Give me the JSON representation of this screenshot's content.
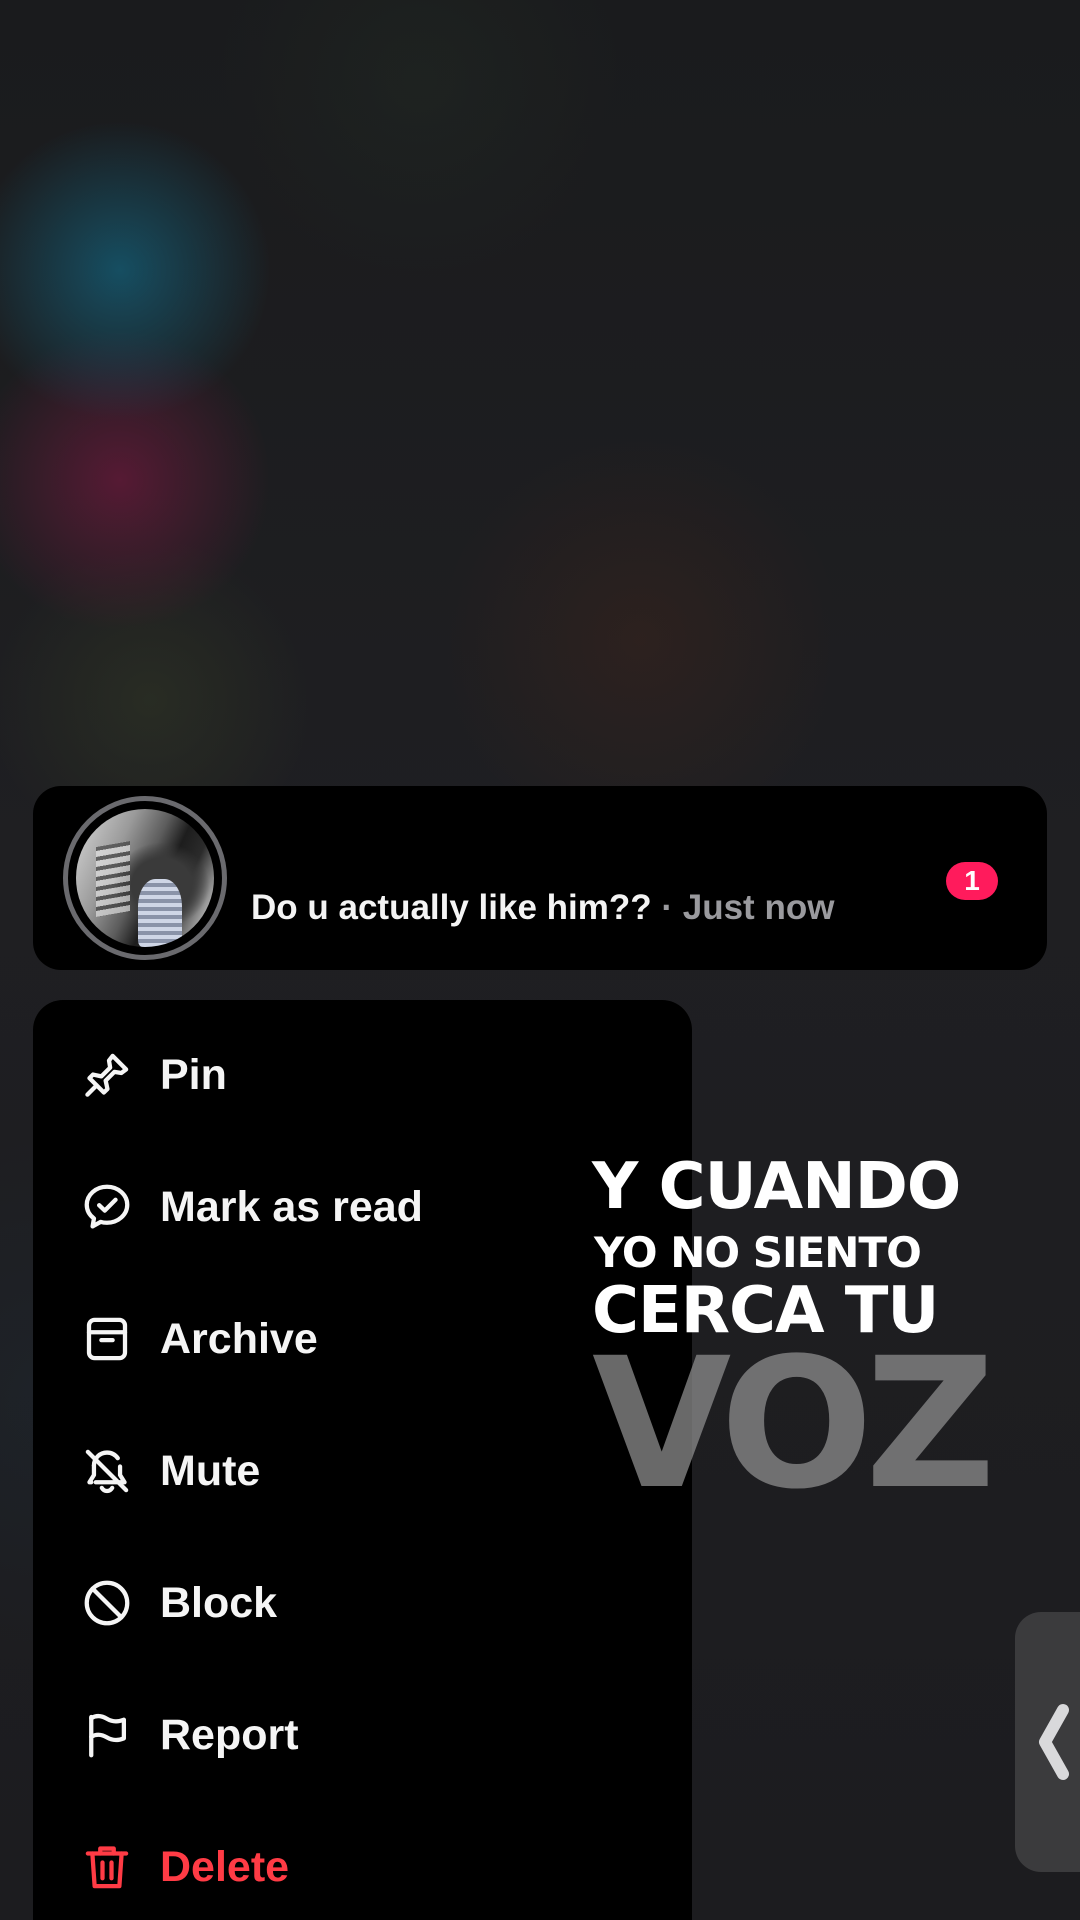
{
  "conversation": {
    "message": "Do u actually like him??",
    "separator": " · ",
    "time": "Just now",
    "unread_count": "1",
    "accent_color": "#ff1b5c"
  },
  "menu": {
    "items": [
      {
        "label": "Pin",
        "icon": "pin-icon"
      },
      {
        "label": "Mark as read",
        "icon": "mark-read-icon"
      },
      {
        "label": "Archive",
        "icon": "archive-icon"
      },
      {
        "label": "Mute",
        "icon": "bell-off-icon"
      },
      {
        "label": "Block",
        "icon": "block-icon"
      },
      {
        "label": "Report",
        "icon": "flag-icon"
      },
      {
        "label": "Delete",
        "icon": "trash-icon",
        "color": "#ff3b45"
      }
    ]
  },
  "overlay": {
    "line1": "Y CUANDO",
    "line2": "YO NO SIENTO",
    "line3": "CERCA TU",
    "line4": "VOZ"
  },
  "side_handle": {
    "icon": "chevron-left-icon"
  }
}
